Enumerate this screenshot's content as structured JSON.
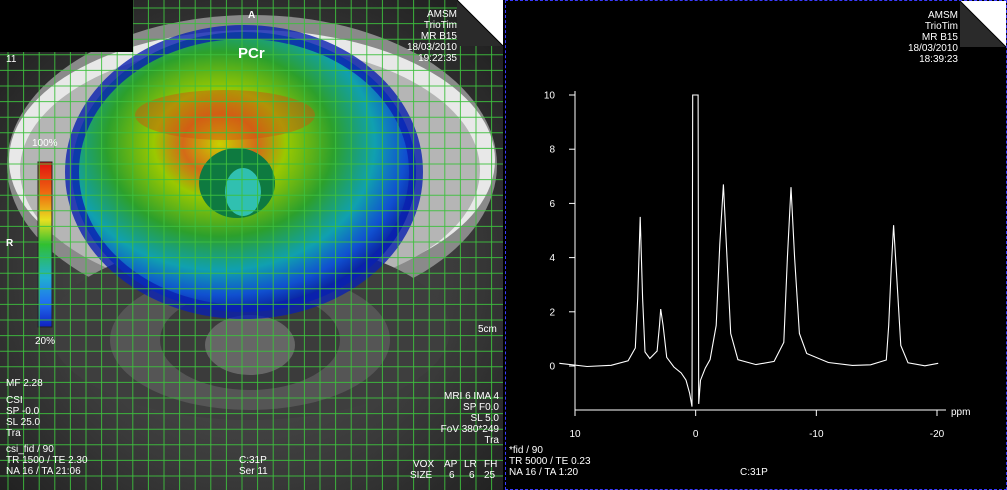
{
  "left": {
    "orientation_top": "A",
    "orientation_left": "R",
    "metabolite": "PCr",
    "slice_number": "11",
    "header": [
      "AMSM",
      "TrioTim",
      "MR B15",
      "18/03/2010",
      "19:22:35"
    ],
    "colorbar": {
      "max_label": "100%",
      "min_label": "20%"
    },
    "scale_label": "5cm",
    "bottom_left": [
      "MF 2.28",
      "CSI",
      "SP -0.0",
      "SL 25.0",
      "Tra",
      "csi_fid / 90",
      "TR 1500 / TE 2.30",
      "NA 16 / TA 21:06"
    ],
    "bottom_center": [
      "C:31P",
      "Ser 11"
    ],
    "bottom_right": [
      "MRI 6 IMA 4",
      "SP F0.0",
      "SL 5.0",
      "FoV 380*249",
      "Tra"
    ],
    "vox_table": {
      "row_labels": [
        "VOX",
        "SIZE"
      ],
      "columns": [
        [
          "AP",
          "6"
        ],
        [
          "LR",
          "6"
        ],
        [
          "FH",
          "25"
        ]
      ]
    }
  },
  "right": {
    "header": [
      "AMSM",
      "TrioTim",
      "MR B15",
      "18/03/2010",
      "18:39:23"
    ],
    "bottom_left": [
      "*fid / 90",
      "TR 5000 / TE 0.23",
      "NA 16 / TA 1:20"
    ],
    "bottom_center": "C:31P"
  },
  "chart_data": {
    "type": "line",
    "title": "",
    "xlabel": "ppm",
    "ylabel": "",
    "x_ticks": [
      "10",
      "0",
      "-10",
      "-20"
    ],
    "y_ticks": [
      "0",
      "2",
      "4",
      "6",
      "8",
      "10"
    ],
    "xlim": [
      10,
      -20
    ],
    "ylim": [
      -1.6,
      10
    ],
    "series": [
      {
        "values": [
          [
            11.3,
            0.1
          ],
          [
            9.0,
            0.05
          ],
          [
            7.0,
            0.1
          ],
          [
            5.6,
            0.2
          ],
          [
            5.0,
            0.6
          ],
          [
            4.8,
            2.5
          ],
          [
            4.6,
            5.5
          ],
          [
            4.4,
            2.5
          ],
          [
            4.2,
            0.6
          ],
          [
            3.8,
            0.3
          ],
          [
            3.2,
            0.5
          ],
          [
            3.0,
            1.5
          ],
          [
            2.9,
            2.1
          ],
          [
            2.7,
            1.5
          ],
          [
            2.4,
            0.4
          ],
          [
            1.8,
            0.0
          ],
          [
            1.2,
            -0.3
          ],
          [
            0.8,
            -0.6
          ],
          [
            0.5,
            -1.0
          ],
          [
            0.3,
            -1.5
          ],
          [
            0.25,
            10.0
          ],
          [
            0.15,
            10.0
          ],
          [
            0.1,
            10.0
          ],
          [
            -0.2,
            10.0
          ],
          [
            -0.25,
            -1.4
          ],
          [
            -0.4,
            -0.5
          ],
          [
            -0.8,
            0.0
          ],
          [
            -1.2,
            0.3
          ],
          [
            -1.7,
            1.5
          ],
          [
            -2.0,
            4.5
          ],
          [
            -2.3,
            6.7
          ],
          [
            -2.6,
            4.0
          ],
          [
            -2.9,
            1.2
          ],
          [
            -3.5,
            0.3
          ],
          [
            -5.0,
            0.05
          ],
          [
            -6.5,
            0.1
          ],
          [
            -7.3,
            0.8
          ],
          [
            -7.6,
            4.0
          ],
          [
            -7.9,
            6.6
          ],
          [
            -8.2,
            4.0
          ],
          [
            -8.6,
            1.2
          ],
          [
            -9.2,
            0.4
          ],
          [
            -11.0,
            0.05
          ],
          [
            -13.0,
            0.0
          ],
          [
            -14.5,
            0.1
          ],
          [
            -15.8,
            0.3
          ],
          [
            -16.0,
            1.5
          ],
          [
            -16.2,
            3.5
          ],
          [
            -16.4,
            5.2
          ],
          [
            -16.7,
            3.0
          ],
          [
            -17.0,
            0.8
          ],
          [
            -17.6,
            0.2
          ],
          [
            -19.0,
            0.05
          ],
          [
            -20.1,
            0.1
          ]
        ]
      }
    ]
  }
}
